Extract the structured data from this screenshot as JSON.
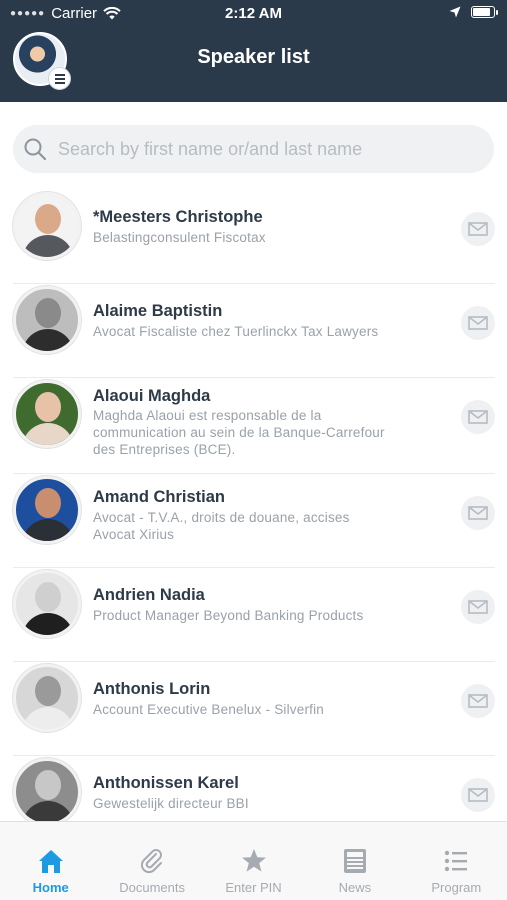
{
  "status_bar": {
    "carrier": "Carrier",
    "time": "2:12 AM",
    "battery_level": 0.9
  },
  "header": {
    "title": "Speaker list"
  },
  "search": {
    "placeholder": "Search by first name or/and last name",
    "value": ""
  },
  "speakers": [
    {
      "name": "*Meesters Christophe",
      "desc": "Belastingconsulent Fiscotax"
    },
    {
      "name": "Alaime Baptistin",
      "desc": "Avocat Fiscaliste chez Tuerlinckx Tax Lawyers"
    },
    {
      "name": "Alaoui Maghda",
      "desc": "Maghda Alaoui est responsable de la communication au sein de la  Banque-Carrefour des Entreprises (BCE)."
    },
    {
      "name": "Amand Christian",
      "desc": "Avocat - T.V.A., droits de douane, accises Avocat Xirius"
    },
    {
      "name": "Andrien Nadia",
      "desc": "Product Manager Beyond Banking Products"
    },
    {
      "name": "Anthonis Lorin",
      "desc": "Account Executive Benelux - Silverfin"
    },
    {
      "name": "Anthonissen Karel",
      "desc": "Gewestelijk directeur BBI"
    }
  ],
  "tabs": [
    {
      "label": "Home",
      "icon": "home-icon",
      "active": true
    },
    {
      "label": "Documents",
      "icon": "paperclip-icon",
      "active": false
    },
    {
      "label": "Enter PIN",
      "icon": "star-icon",
      "active": false
    },
    {
      "label": "News",
      "icon": "newspaper-icon",
      "active": false
    },
    {
      "label": "Program",
      "icon": "list-icon",
      "active": false
    }
  ],
  "colors": {
    "header_bg": "#2b3a4a",
    "accent": "#1e9be0",
    "muted": "#a6abb1"
  }
}
